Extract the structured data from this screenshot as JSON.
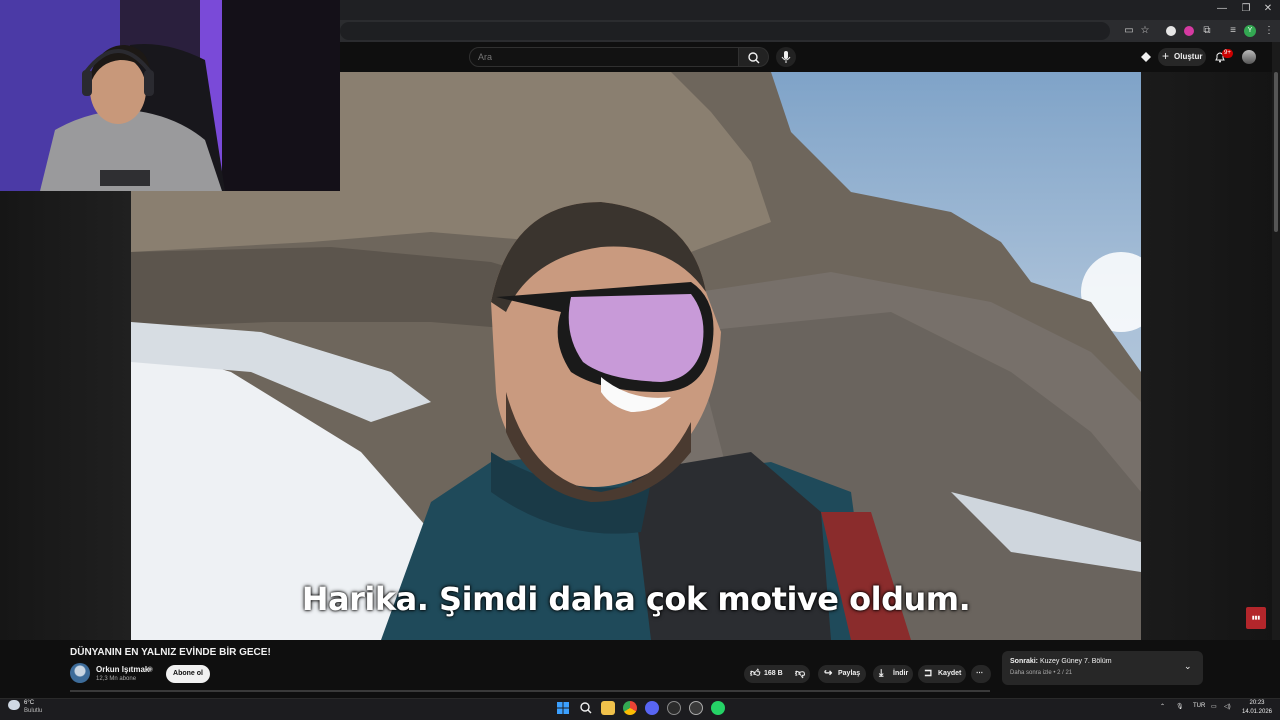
{
  "browser": {
    "window_controls": [
      "—",
      "❐",
      "✕"
    ],
    "profile_initial": "Y"
  },
  "masthead": {
    "search_placeholder": "Ara",
    "create_label": "Oluştur",
    "notif_badge": "9+"
  },
  "video": {
    "subtitle": "Harika. Şimdi daha çok motive oldum."
  },
  "watch": {
    "title": "DÜNYANIN EN YALNIZ EVİNDE BİR GECE!",
    "channel_name": "Orkun Işıtmak",
    "verified_mark": "◉",
    "subscribers": "12,3 Mn abone",
    "subscribe_label": "Abone ol",
    "like_count": "168 B",
    "share_label": "Paylaş",
    "download_label": "İndir",
    "save_label": "Kaydet",
    "more_label": "⋯",
    "up_next": {
      "prefix": "Sonraki:",
      "title": "Kuzey Güney 7. Bölüm",
      "subtitle": "Daha sonra izle • 2 / 21"
    }
  },
  "taskbar": {
    "weather_temp": "6°C",
    "weather_cond": "Bulutlu",
    "lang": "TUR",
    "time": "20:23",
    "date": "14.01.2026"
  },
  "colors": {
    "bg": "#0f0f0f",
    "pill": "#272727",
    "accent_red": "#cc0000"
  }
}
